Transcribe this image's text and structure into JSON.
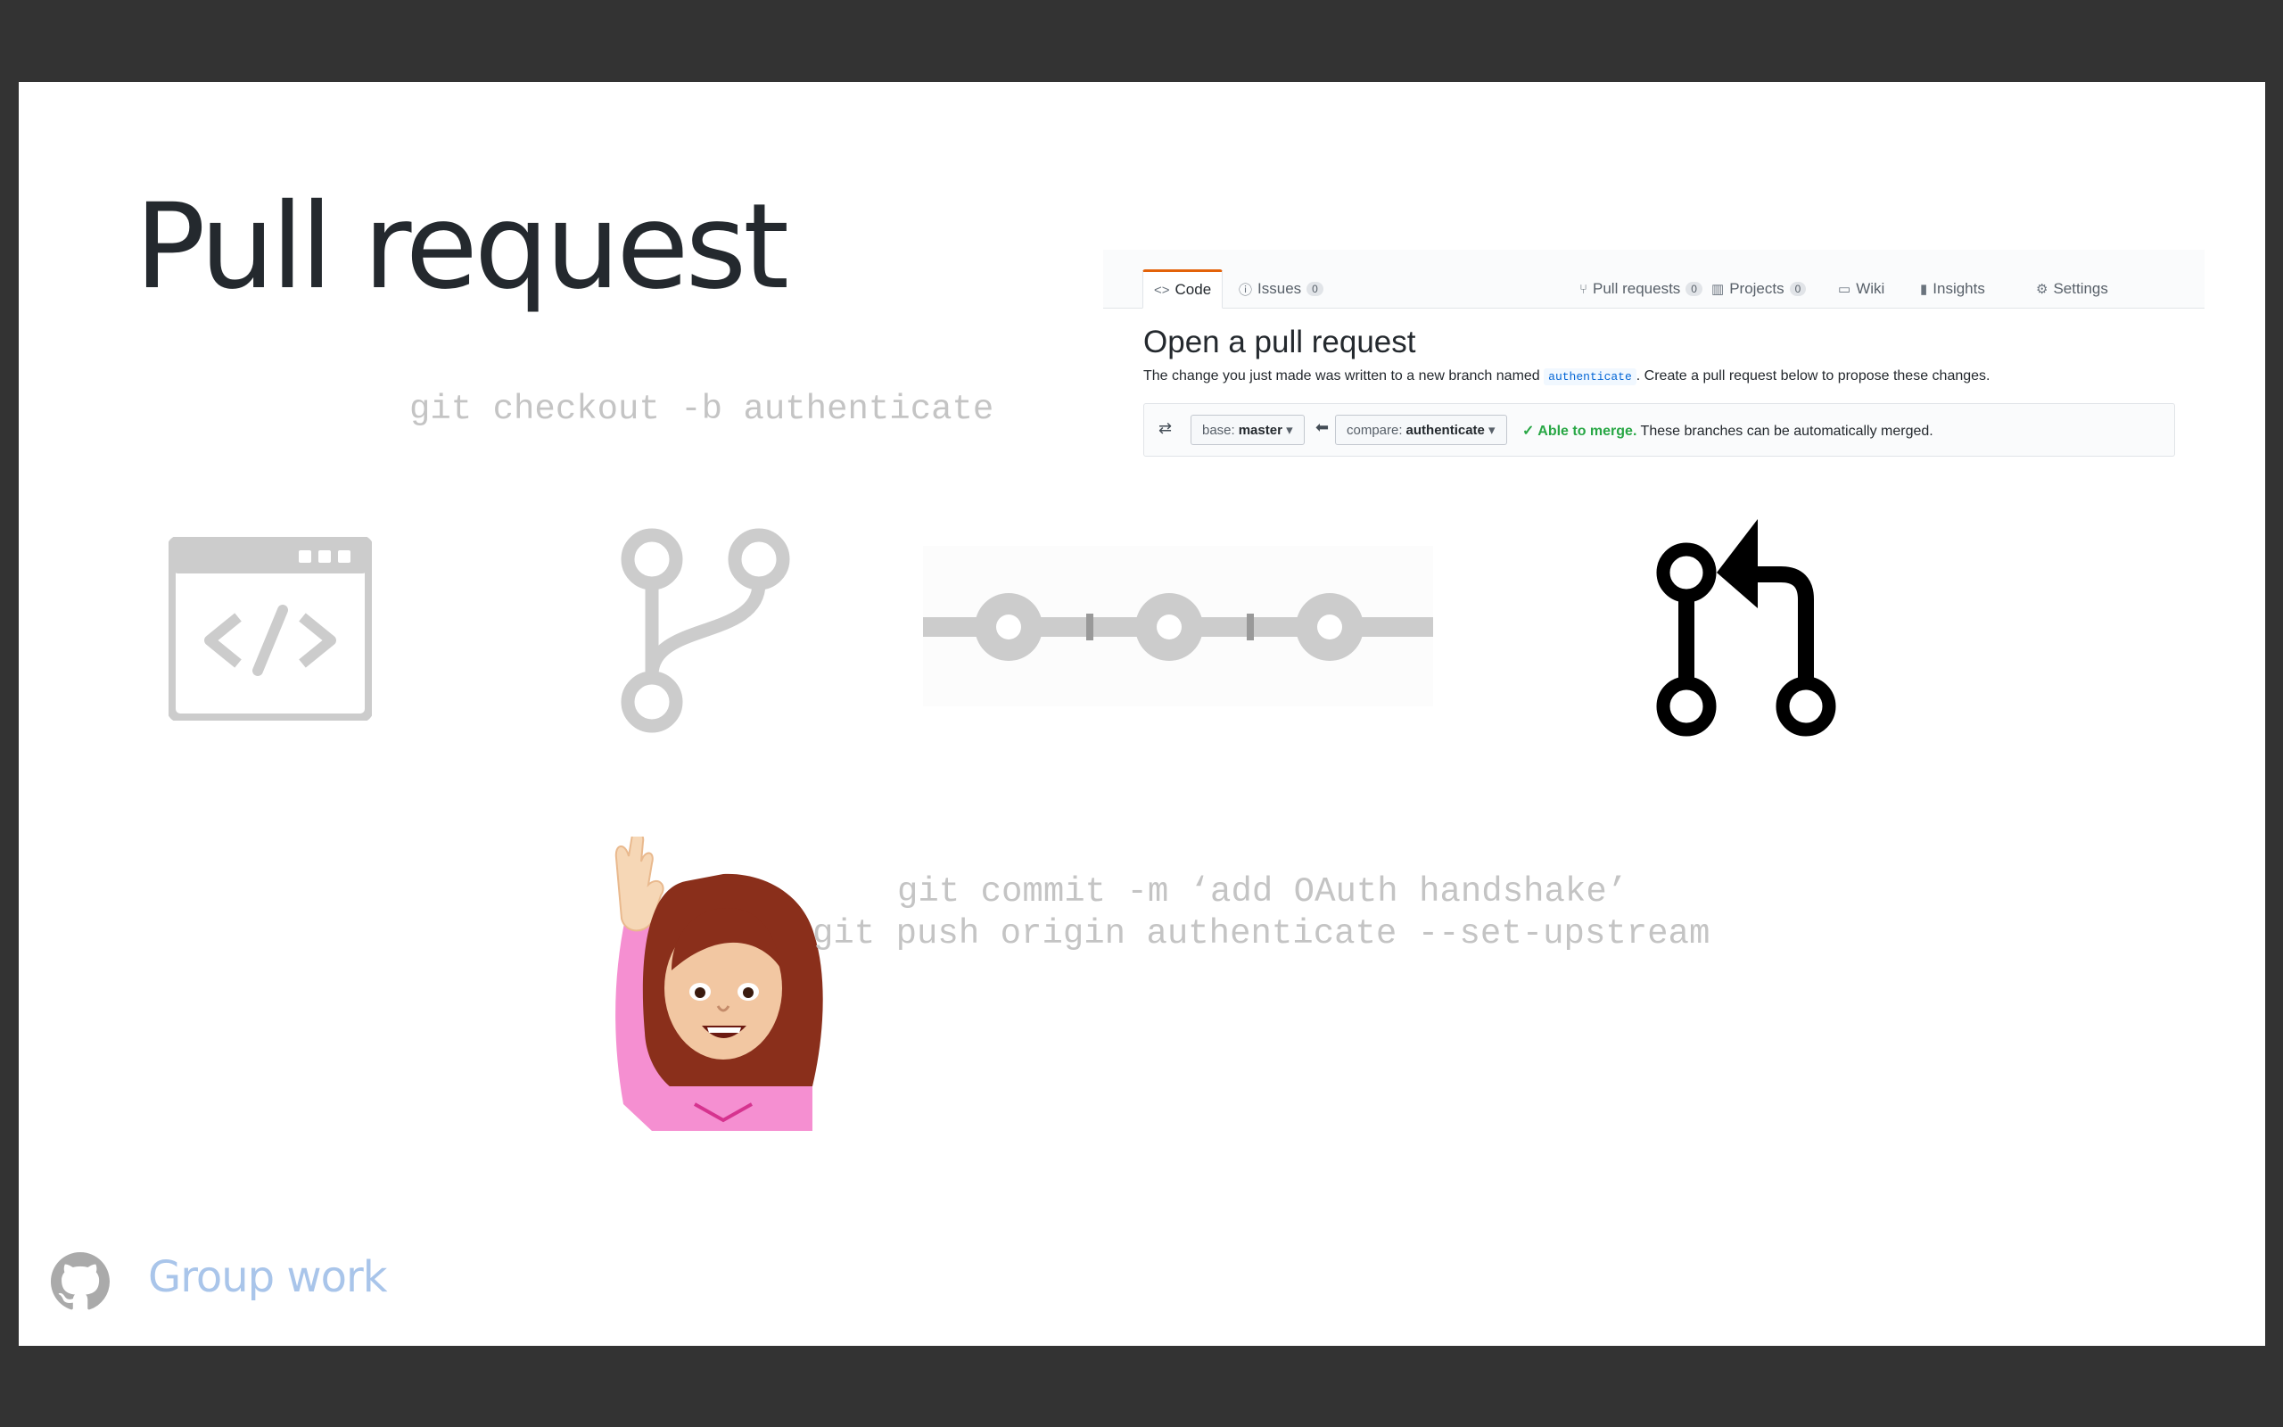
{
  "slide": {
    "title": "Pull request",
    "commands": {
      "checkout": "git checkout -b authenticate",
      "commit": "git commit -m ‘add OAuth handshake’",
      "push": "git push origin authenticate --set-upstream"
    }
  },
  "github": {
    "tabs": [
      {
        "label": "Code",
        "icon": "code-icon",
        "count": ""
      },
      {
        "label": "Issues",
        "icon": "issue-icon",
        "count": "0"
      },
      {
        "label": "Pull requests",
        "icon": "pull-request-icon",
        "count": "0"
      },
      {
        "label": "Projects",
        "icon": "project-icon",
        "count": "0"
      },
      {
        "label": "Wiki",
        "icon": "book-icon",
        "count": ""
      },
      {
        "label": "Insights",
        "icon": "graph-icon",
        "count": ""
      },
      {
        "label": "Settings",
        "icon": "gear-icon",
        "count": ""
      }
    ],
    "heading": "Open a pull request",
    "desc_before": "The change you just made was written to a new branch named",
    "branch_code": "authenticate",
    "desc_after": ". Create a pull request below to propose these changes.",
    "base_prefix": "base:",
    "base_value": "master",
    "compare_prefix": "compare:",
    "compare_value": "authenticate",
    "merge_status": "✓ Able to merge.",
    "merge_note": "These branches can be automatically merged.",
    "colors": {
      "accent": "#e36209",
      "success": "#28a745"
    }
  },
  "icons": [
    "code-window-icon",
    "branch-icon",
    "commits-icon",
    "pull-request-icon",
    "raising-hand-emoji"
  ],
  "footer": {
    "label": "Group work",
    "icon": "github-octocat-icon",
    "color": "#a9c5ea"
  }
}
